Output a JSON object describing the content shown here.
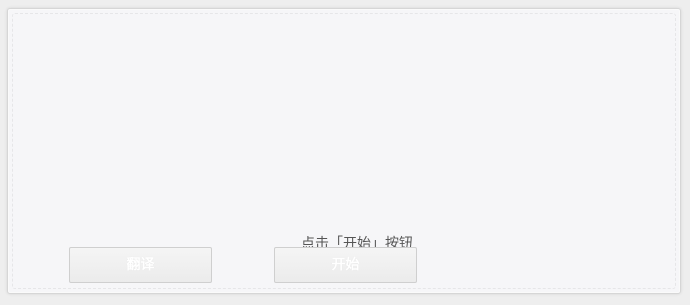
{
  "hint": {
    "text": "点击「开始」按钮"
  },
  "buttons": {
    "translate_label": "翻译",
    "start_label": "开始"
  }
}
